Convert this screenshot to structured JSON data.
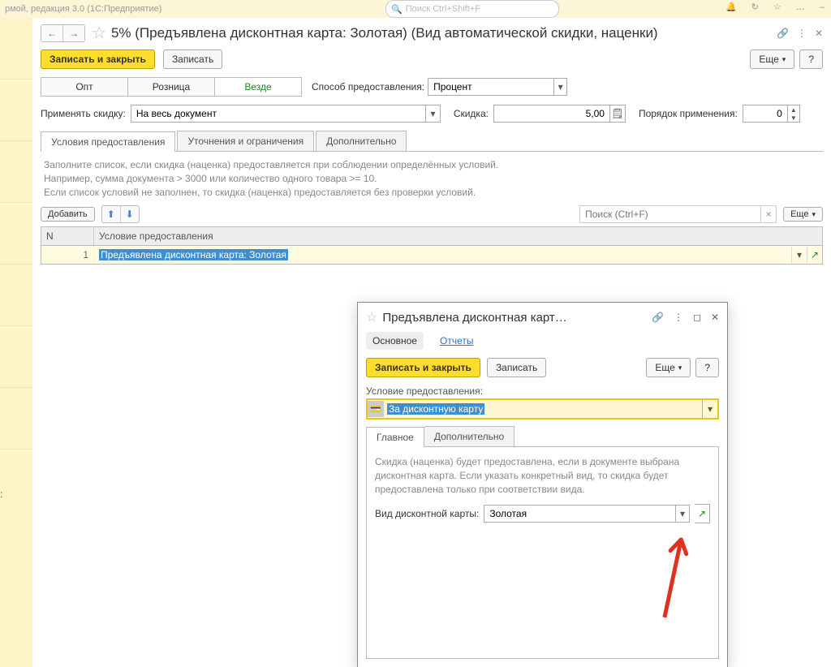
{
  "topbar": {
    "title_fragment": "рмой, редакция 3.0   (1С:Предприятие)",
    "search_placeholder": "Поиск Ctrl+Shift+F"
  },
  "header": {
    "title": "5% (Предъявлена дисконтная карта: Золотая) (Вид автоматической скидки, наценки)",
    "write_close": "Записать и закрыть",
    "write": "Записать",
    "more": "Еще",
    "help": "?"
  },
  "segments": {
    "opt": "Опт",
    "retail": "Розница",
    "everywhere": "Везде"
  },
  "provide": {
    "label": "Способ предоставления:",
    "value": "Процент"
  },
  "apply": {
    "label": "Применять скидку:",
    "value": "На весь документ"
  },
  "discount": {
    "label": "Скидка:",
    "value": "5,00"
  },
  "order": {
    "label": "Порядок применения:",
    "value": "0"
  },
  "tabs": {
    "cond": "Условия предоставления",
    "refine": "Уточнения и ограничения",
    "extra": "Дополнительно"
  },
  "hint": {
    "l1": "Заполните список, если скидка (наценка) предоставляется при соблюдении определённых условий.",
    "l2": "Например, сумма документа > 3000 или количество одного товара >= 10.",
    "l3": "Если список условий не заполнен, то скидка (наценка) предоставляется без проверки условий."
  },
  "listbar": {
    "add": "Добавить",
    "search_placeholder": "Поиск (Ctrl+F)",
    "more": "Еще"
  },
  "table": {
    "col_n": "N",
    "col_cond": "Условие предоставления",
    "rows": [
      {
        "n": "1",
        "cond": "Предъявлена дисконтная карта: Золотая"
      }
    ]
  },
  "popup": {
    "title": "Предъявлена дисконтная карт…",
    "sub_main": "Основное",
    "sub_reports": "Отчеты",
    "write_close": "Записать и закрыть",
    "write": "Записать",
    "more": "Еще",
    "help": "?",
    "cond_label": "Условие предоставления:",
    "cond_value": "За дисконтную карту",
    "tab_main": "Главное",
    "tab_extra": "Дополнительно",
    "desc": "Скидка (наценка) будет предоставлена, если в документе выбрана дисконтная карта. Если указать конкретный вид, то скидка будет предоставлена только при соответствии вида.",
    "kind_label": "Вид дисконтной карты:",
    "kind_value": "Золотая"
  }
}
